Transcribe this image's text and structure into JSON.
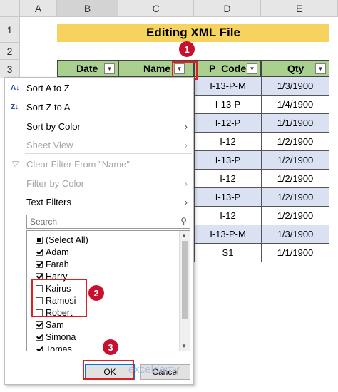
{
  "sheet": {
    "columns": [
      "A",
      "B",
      "C",
      "D",
      "E"
    ],
    "rows": [
      "1",
      "2",
      "3"
    ],
    "title": "Editing XML File",
    "headers": [
      "Date",
      "Name",
      "P_Code",
      "Qty"
    ],
    "pcodes": [
      "I-13-P-M",
      "I-13-P",
      "I-12-P",
      "I-12",
      "I-13-P",
      "I-12",
      "I-13-P",
      "I-12",
      "I-13-P-M",
      "S1"
    ],
    "qtys": [
      "1/3/1900",
      "1/4/1900",
      "1/1/1900",
      "1/2/1900",
      "1/2/1900",
      "1/2/1900",
      "1/2/1900",
      "1/2/1900",
      "1/3/1900",
      "1/1/1900"
    ]
  },
  "menu": {
    "sort_az": "Sort A to Z",
    "sort_za": "Sort Z to A",
    "sort_color": "Sort by Color",
    "sheet_view": "Sheet View",
    "clear_filter": "Clear Filter From \"Name\"",
    "filter_color": "Filter by Color",
    "text_filters": "Text Filters",
    "search_placeholder": "Search",
    "items": [
      {
        "label": "(Select All)",
        "state": "partial"
      },
      {
        "label": "Adam",
        "state": "checked"
      },
      {
        "label": "Farah",
        "state": "checked"
      },
      {
        "label": "Harry",
        "state": "checked"
      },
      {
        "label": "Kairus",
        "state": "unchecked"
      },
      {
        "label": "Ramosi",
        "state": "unchecked"
      },
      {
        "label": "Robert",
        "state": "unchecked"
      },
      {
        "label": "Sam",
        "state": "checked"
      },
      {
        "label": "Simona",
        "state": "checked"
      },
      {
        "label": "Tomas",
        "state": "checked"
      }
    ],
    "ok": "OK",
    "cancel": "Cancel"
  },
  "markers": [
    "1",
    "2",
    "3"
  ],
  "watermark": "exceldemy"
}
